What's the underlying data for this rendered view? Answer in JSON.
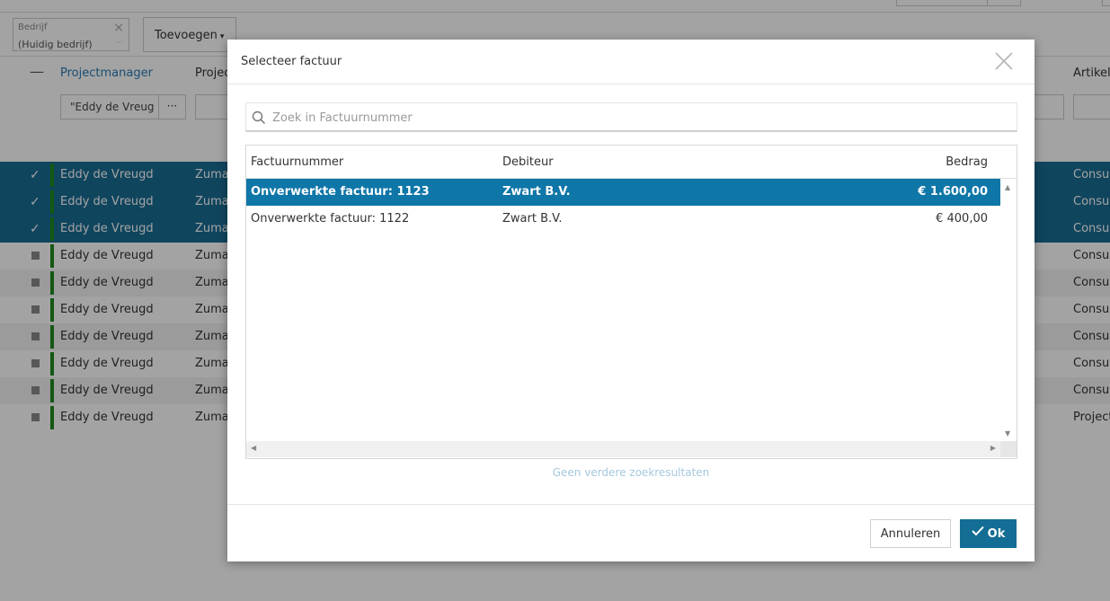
{
  "background": {
    "filter_chip": {
      "label": "Bedrijf",
      "value": "(Huidig bedrijf)",
      "close": "×",
      "more": "···"
    },
    "add_button": {
      "label": "Toevoegen",
      "caret": "▾"
    },
    "columns": {
      "collapse": "—",
      "projectmanager": "Projectmanager",
      "project": "Projec",
      "artikel": "Artikel"
    },
    "pm_filter": {
      "value": "\"Eddy de Vreug",
      "more": "···"
    },
    "rows": [
      {
        "name": "Eddy de Vreugd",
        "project": "Zuma",
        "artikel": "Consul",
        "state": "selected"
      },
      {
        "name": "Eddy de Vreugd",
        "project": "Zuma",
        "artikel": "Consul",
        "state": "selected"
      },
      {
        "name": "Eddy de Vreugd",
        "project": "Zuma",
        "artikel": "Consul",
        "state": "selected"
      },
      {
        "name": "Eddy de Vreugd",
        "project": "Zuma",
        "artikel": "Consul",
        "state": "normal"
      },
      {
        "name": "Eddy de Vreugd",
        "project": "Zuma",
        "artikel": "Consul",
        "state": "alt"
      },
      {
        "name": "Eddy de Vreugd",
        "project": "Zuma",
        "artikel": "Consul",
        "state": "normal"
      },
      {
        "name": "Eddy de Vreugd",
        "project": "Zuma",
        "artikel": "Consul",
        "state": "alt"
      },
      {
        "name": "Eddy de Vreugd",
        "project": "Zuma",
        "artikel": "Consul",
        "state": "normal"
      },
      {
        "name": "Eddy de Vreugd",
        "project": "Zuma",
        "artikel": "Consul",
        "state": "alt"
      },
      {
        "name": "Eddy de Vreugd",
        "project": "Zuma",
        "artikel": "Project",
        "state": "normal"
      }
    ],
    "check_glyph": "✓"
  },
  "modal": {
    "title": "Selecteer factuur",
    "search": {
      "placeholder": "Zoek in Factuurnummer",
      "value": ""
    },
    "table": {
      "headers": {
        "factuurnummer": "Factuurnummer",
        "debiteur": "Debiteur",
        "bedrag": "Bedrag"
      },
      "rows": [
        {
          "factuurnummer": "Onverwerkte factuur: 1123",
          "debiteur": "Zwart B.V.",
          "bedrag": "€ 1.600,00",
          "selected": true
        },
        {
          "factuurnummer": "Onverwerkte factuur: 1122",
          "debiteur": "Zwart B.V.",
          "bedrag": "€ 400,00",
          "selected": false
        }
      ],
      "scroll_up": "▲",
      "scroll_down": "▼",
      "scroll_left": "◀",
      "scroll_right": "▶"
    },
    "no_more_results": "Geen verdere zoekresultaten",
    "cancel_label": "Annuleren",
    "ok_label": "Ok"
  },
  "colors": {
    "selected_row": "#0f76a8",
    "background_selected": "#1a6c94",
    "primary_button": "#146d94",
    "status_bar": "#1e8a1e",
    "link_blue": "#2a7ab5"
  },
  "icons": {
    "close": "close-icon",
    "search": "search-icon",
    "ok_check": "check-icon"
  }
}
